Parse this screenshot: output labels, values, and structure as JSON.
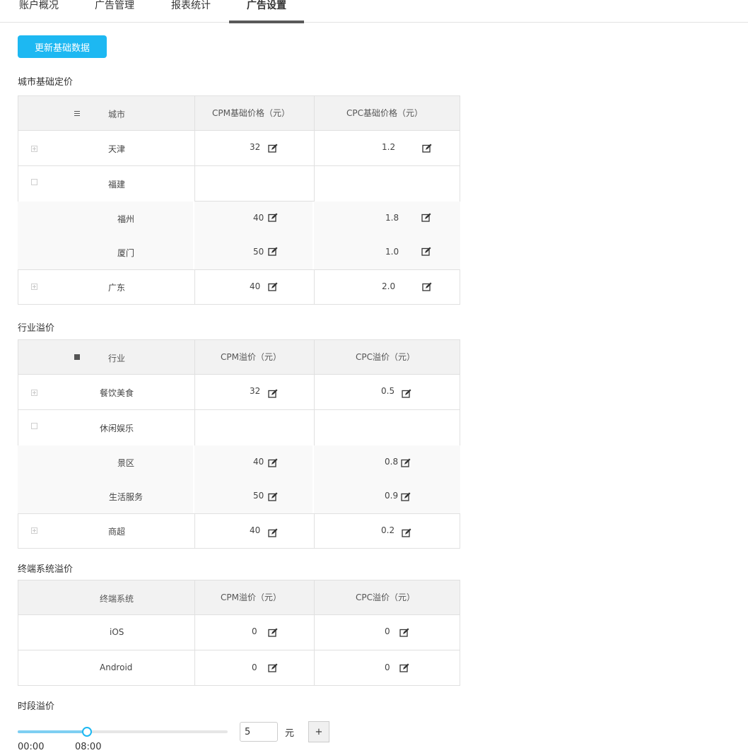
{
  "tabs": [
    {
      "label": "账户概况"
    },
    {
      "label": "广告管理"
    },
    {
      "label": "报表统计"
    },
    {
      "label": "广告设置"
    }
  ],
  "update_button": "更新基础数据",
  "city": {
    "title": "城市基础定价",
    "headers": [
      "城市",
      "CPM基础价格（元）",
      "CPC基础价格（元）"
    ],
    "rows": [
      {
        "name": "天津",
        "cpm": "32",
        "cpc": "1.2"
      },
      {
        "name": "福建"
      },
      {
        "name": "福州",
        "cpm": "40",
        "cpc": "1.8"
      },
      {
        "name": "厦门",
        "cpm": "50",
        "cpc": "1.0"
      },
      {
        "name": "广东",
        "cpm": "40",
        "cpc": "2.0"
      }
    ]
  },
  "industry": {
    "title": "行业溢价",
    "headers": [
      "行业",
      "CPM溢价（元）",
      "CPC溢价（元）"
    ],
    "rows": [
      {
        "name": "餐饮美食",
        "cpm": "32",
        "cpc": "0.5"
      },
      {
        "name": "休闲娱乐"
      },
      {
        "name": "景区",
        "cpm": "40",
        "cpc": "0.8"
      },
      {
        "name": "生活服务",
        "cpm": "50",
        "cpc": "0.9"
      },
      {
        "name": "商超",
        "cpm": "40",
        "cpc": "0.2"
      }
    ]
  },
  "os": {
    "title": "终端系统溢价",
    "headers": [
      "终端系统",
      "CPM溢价（元）",
      "CPC溢价（元）"
    ],
    "rows": [
      {
        "name": "iOS",
        "cpm": "0",
        "cpc": "0"
      },
      {
        "name": "Android",
        "cpm": "0",
        "cpc": "0"
      }
    ]
  },
  "time": {
    "title": "时段溢价",
    "input_value": "5",
    "unit": "元",
    "plus_label": "+",
    "start_label": "00:00",
    "end_label": "08:00",
    "slider_fraction": 0.33
  },
  "colors": {
    "accent": "#1db8f2",
    "track_fill": "#7ecff2"
  },
  "icons": {
    "edit": "edit-icon",
    "list": "list-icon",
    "expand": "expand-icon"
  }
}
